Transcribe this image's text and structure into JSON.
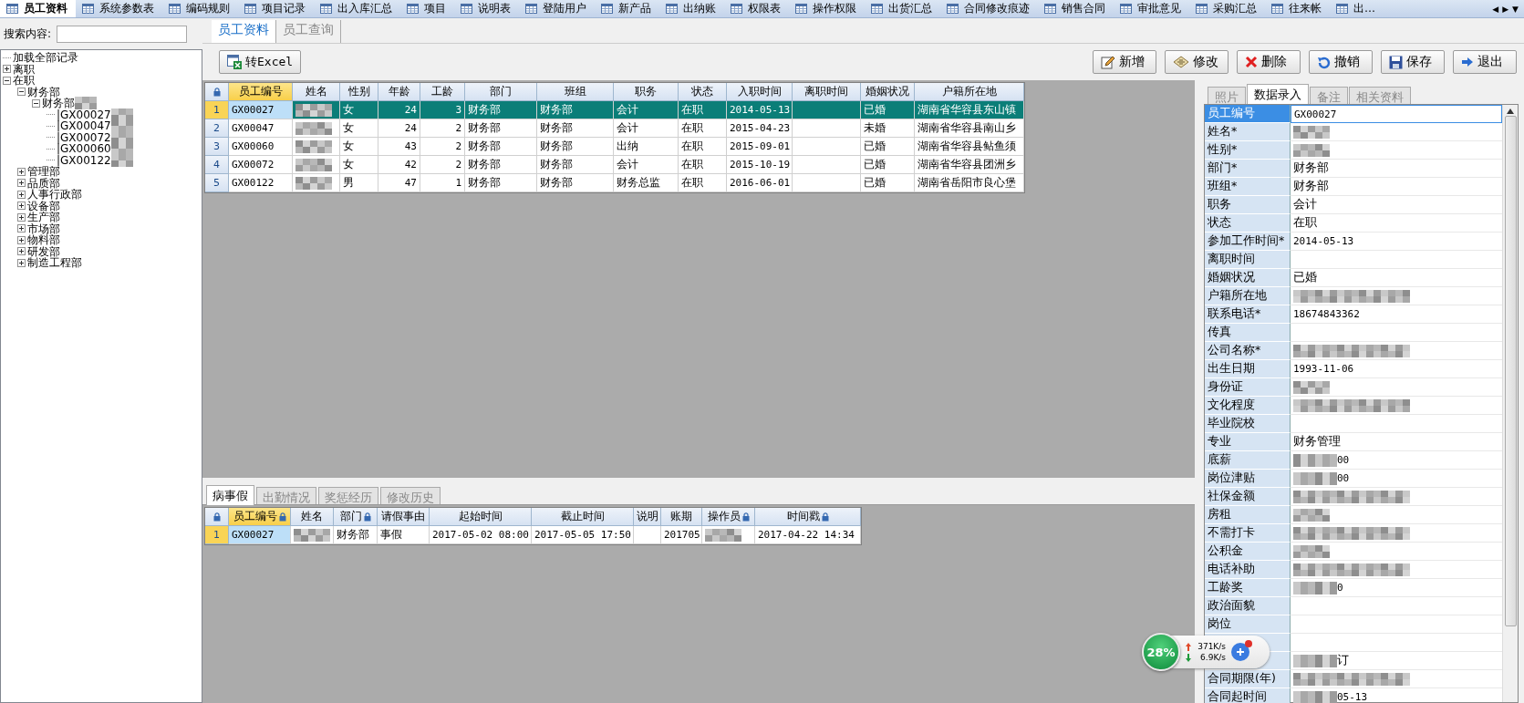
{
  "top_tabs": [
    {
      "label": "员工资料",
      "selected": true
    },
    {
      "label": "系统参数表",
      "selected": false
    },
    {
      "label": "编码规则",
      "selected": false
    },
    {
      "label": "项目记录",
      "selected": false
    },
    {
      "label": "出入库汇总",
      "selected": false
    },
    {
      "label": "项目",
      "selected": false
    },
    {
      "label": "说明表",
      "selected": false
    },
    {
      "label": "登陆用户",
      "selected": false
    },
    {
      "label": "新产品",
      "selected": false
    },
    {
      "label": "出纳账",
      "selected": false
    },
    {
      "label": "权限表",
      "selected": false
    },
    {
      "label": "操作权限",
      "selected": false
    },
    {
      "label": "出货汇总",
      "selected": false
    },
    {
      "label": "合同修改痕迹",
      "selected": false
    },
    {
      "label": "销售合同",
      "selected": false
    },
    {
      "label": "审批意见",
      "selected": false
    },
    {
      "label": "采购汇总",
      "selected": false
    },
    {
      "label": "往来帐",
      "selected": false
    },
    {
      "label": "出…",
      "selected": false
    }
  ],
  "tab_scroll": [
    "◀",
    "▶",
    "▼"
  ],
  "search": {
    "label": "搜索内容:"
  },
  "tree": [
    {
      "label": "加载全部记录"
    },
    {
      "label": "离职",
      "expanded": false
    },
    {
      "label": "在职",
      "expanded": true,
      "children": [
        {
          "label": "财务部",
          "expanded": true,
          "children": [
            {
              "label": "财务部",
              "redacted": true,
              "expanded": true,
              "children": [
                {
                  "label": "|GX00027",
                  "redacted": true
                },
                {
                  "label": "|GX00047",
                  "redacted": true
                },
                {
                  "label": "|GX00072",
                  "redacted": true
                },
                {
                  "label": "|GX00060",
                  "redacted": true
                },
                {
                  "label": "|GX00122",
                  "redacted": true
                }
              ]
            }
          ]
        },
        {
          "label": "管理部",
          "expanded": false
        },
        {
          "label": "品质部",
          "expanded": false
        },
        {
          "label": "人事行政部",
          "expanded": false
        },
        {
          "label": "设备部",
          "expanded": false
        },
        {
          "label": "生产部",
          "expanded": false
        },
        {
          "label": "市场部",
          "expanded": false
        },
        {
          "label": "物料部",
          "expanded": false
        },
        {
          "label": "研发部",
          "expanded": false
        },
        {
          "label": "制造工程部",
          "expanded": false
        }
      ]
    }
  ],
  "sub_tabs": [
    {
      "label": "员工资料",
      "selected": true
    },
    {
      "label": "员工查询",
      "selected": false
    }
  ],
  "excel_button": "转Excel",
  "actions": [
    {
      "label": "新增",
      "kind": "add"
    },
    {
      "label": "修改",
      "kind": "edit"
    },
    {
      "label": "删除",
      "kind": "delete"
    },
    {
      "label": "撤销",
      "kind": "undo"
    },
    {
      "label": "保存",
      "kind": "save"
    },
    {
      "label": "退出",
      "kind": "exit"
    }
  ],
  "employee_table": {
    "columns": [
      {
        "label": "员工编号",
        "selected": true
      },
      {
        "label": "姓名",
        "selected": false
      },
      {
        "label": "性别",
        "selected": false
      },
      {
        "label": "年龄",
        "selected": false,
        "kind": "number"
      },
      {
        "label": "工龄",
        "selected": false,
        "kind": "number"
      },
      {
        "label": "部门",
        "selected": false
      },
      {
        "label": "班组",
        "selected": false
      },
      {
        "label": "职务",
        "selected": false
      },
      {
        "label": "状态",
        "selected": false
      },
      {
        "label": "入职时间",
        "selected": false
      },
      {
        "label": "离职时间",
        "selected": false
      },
      {
        "label": "婚姻状况",
        "selected": false
      },
      {
        "label": "户籍所在地",
        "selected": false
      }
    ],
    "rows": [
      {
        "number": "1",
        "selected": true,
        "cells": [
          "GX00027",
          {
            "redacted": true
          },
          "女",
          "24",
          "3",
          "财务部",
          "财务部",
          "会计",
          "在职",
          "2014-05-13",
          null,
          "已婚",
          "湖南省华容县东山镇"
        ]
      },
      {
        "number": "2",
        "selected": false,
        "cells": [
          "GX00047",
          {
            "redacted": true
          },
          "女",
          "24",
          "2",
          "财务部",
          "财务部",
          "会计",
          "在职",
          "2015-04-23",
          null,
          "未婚",
          "湖南省华容县南山乡"
        ]
      },
      {
        "number": "3",
        "selected": false,
        "cells": [
          "GX00060",
          {
            "redacted": true
          },
          "女",
          "43",
          "2",
          "财务部",
          "财务部",
          "出纳",
          "在职",
          "2015-09-01",
          null,
          "已婚",
          "湖南省华容县鲇鱼须"
        ]
      },
      {
        "number": "4",
        "selected": false,
        "cells": [
          "GX00072",
          {
            "redacted": true
          },
          "女",
          "42",
          "2",
          "财务部",
          "财务部",
          "会计",
          "在职",
          "2015-10-19",
          null,
          "已婚",
          "湖南省华容县团洲乡"
        ]
      },
      {
        "number": "5",
        "selected": false,
        "cells": [
          "GX00122",
          {
            "redacted": true
          },
          "男",
          "47",
          "1",
          "财务部",
          "财务部",
          "财务总监",
          "在职",
          "2016-06-01",
          null,
          "已婚",
          "湖南省岳阳市良心堡"
        ]
      }
    ]
  },
  "detail_tabs": [
    {
      "label": "病事假",
      "selected": true
    },
    {
      "label": "出勤情况",
      "selected": false
    },
    {
      "label": "奖惩经历",
      "selected": false
    },
    {
      "label": "修改历史",
      "selected": false
    }
  ],
  "leave_table": {
    "columns": [
      {
        "label": "员工编号",
        "selected": true,
        "locked": true
      },
      {
        "label": "姓名",
        "selected": false,
        "locked": false
      },
      {
        "label": "部门",
        "selected": false,
        "locked": true
      },
      {
        "label": "请假事由",
        "selected": false,
        "locked": false
      },
      {
        "label": "起始时间",
        "selected": false,
        "locked": false
      },
      {
        "label": "截止时间",
        "selected": false,
        "locked": false
      },
      {
        "label": "说明",
        "selected": false,
        "locked": false
      },
      {
        "label": "账期",
        "selected": false,
        "locked": false
      },
      {
        "label": "操作员",
        "selected": false,
        "locked": true
      },
      {
        "label": "时间戳",
        "selected": false,
        "locked": true
      }
    ],
    "rows": [
      {
        "number": "1",
        "selected": true,
        "cells": [
          "GX00027",
          {
            "redacted": true
          },
          "财务部",
          "事假",
          "2017-05-02 08:00",
          "2017-05-05 17:50",
          null,
          "201705",
          {
            "redacted": true
          },
          "2017-04-22 14:34"
        ]
      }
    ]
  },
  "property_tabs": [
    {
      "label": "照片",
      "selected": false
    },
    {
      "label": "数据录入",
      "selected": true
    },
    {
      "label": "备注",
      "selected": false
    },
    {
      "label": "相关资料",
      "selected": false
    }
  ],
  "properties": [
    {
      "label": "员工编号",
      "value": "GX00027",
      "selected": true
    },
    {
      "label": "姓名*",
      "redacted": true,
      "selected": false
    },
    {
      "label": "性别*",
      "redacted": true,
      "selected": false
    },
    {
      "label": "部门*",
      "value": "财务部",
      "selected": false
    },
    {
      "label": "班组*",
      "value": "财务部",
      "selected": false
    },
    {
      "label": "职务",
      "value": "会计",
      "selected": false
    },
    {
      "label": "状态",
      "value": "在职",
      "selected": false
    },
    {
      "label": "参加工作时间*",
      "value": "2014-05-13",
      "selected": false
    },
    {
      "label": "离职时间",
      "selected": false
    },
    {
      "label": "婚姻状况",
      "value": "已婚",
      "selected": false
    },
    {
      "label": "户籍所在地",
      "redacted": true,
      "selected": false
    },
    {
      "label": "联系电话*",
      "value": "18674843362",
      "selected": false
    },
    {
      "label": "传真",
      "selected": false
    },
    {
      "label": "公司名称*",
      "redacted": true,
      "selected": false
    },
    {
      "label": "出生日期",
      "value": "1993-11-06",
      "selected": false
    },
    {
      "label": "身份证",
      "redacted": true,
      "selected": false
    },
    {
      "label": "文化程度",
      "redacted": true,
      "selected": false
    },
    {
      "label": "毕业院校",
      "selected": false
    },
    {
      "label": "专业",
      "value": "财务管理",
      "selected": false
    },
    {
      "label": "底薪",
      "value": "00",
      "redacted": true,
      "selected": false
    },
    {
      "label": "岗位津贴",
      "value": "00",
      "redacted": true,
      "selected": false
    },
    {
      "label": "社保金额",
      "redacted": true,
      "selected": false
    },
    {
      "label": "房租",
      "redacted": true,
      "selected": false
    },
    {
      "label": "不需打卡",
      "redacted": true,
      "selected": false
    },
    {
      "label": "公积金",
      "redacted": true,
      "selected": false
    },
    {
      "label": "电话补助",
      "redacted": true,
      "selected": false
    },
    {
      "label": "工龄奖",
      "value": "0",
      "redacted": true,
      "selected": false
    },
    {
      "label": "政治面貌",
      "selected": false
    },
    {
      "label": "岗位",
      "selected": false
    },
    {
      "selected": false
    },
    {
      "value": "订",
      "redacted": true,
      "selected": false
    },
    {
      "label": "合同期限(年)",
      "redacted": true,
      "selected": false
    },
    {
      "label": "合同起时间",
      "value": "05-13",
      "redacted": true,
      "selected": false
    }
  ],
  "network_widget": {
    "percent": "28%",
    "upload": "371K/s",
    "download": "6.9K/s"
  }
}
